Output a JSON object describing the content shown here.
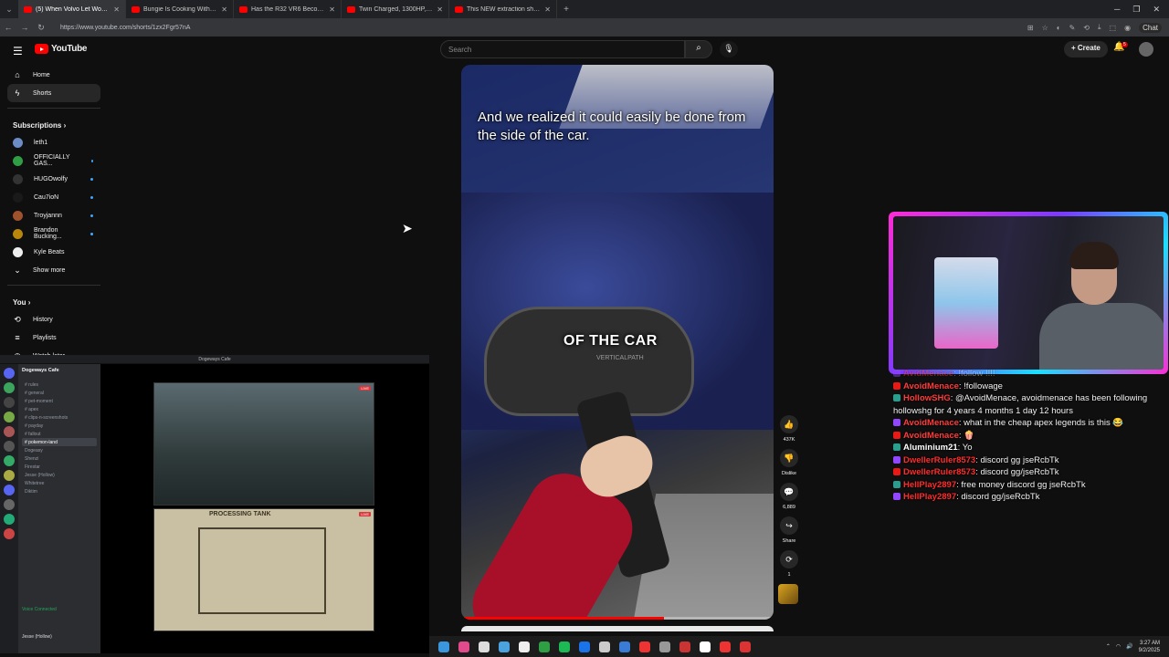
{
  "browser": {
    "tabs": [
      {
        "title": "(5) When Volvo Let Women D...",
        "active": true
      },
      {
        "title": "Bungie Is Cooking With This...",
        "active": false
      },
      {
        "title": "Has the R32 VR6 Become TOO C...",
        "active": false
      },
      {
        "title": "Twin Charged, 1300HP, No Lag...",
        "active": false
      },
      {
        "title": "This NEW extraction shooter is W...",
        "active": false
      }
    ],
    "url": "https://www.youtube.com/shorts/1zx2Fgr57nA",
    "chat_label": "Chat"
  },
  "youtube": {
    "logo_text": "YouTube",
    "search_placeholder": "Search",
    "create_label": "Create",
    "notif_count": "5",
    "sidebar": {
      "home": "Home",
      "shorts": "Shorts",
      "subscriptions_header": "Subscriptions",
      "subscriptions": [
        {
          "name": "leth1",
          "color": "#6b8cc7",
          "live": false
        },
        {
          "name": "OFFICIALLY GAS...",
          "color": "#2f9e44",
          "live": true
        },
        {
          "name": "HUGOwolfy",
          "color": "#333",
          "live": true
        },
        {
          "name": "Cau7ioN",
          "color": "#1a1a1a",
          "live": true
        },
        {
          "name": "Troyjannn",
          "color": "#a0522d",
          "live": true
        },
        {
          "name": "Brandon Bucking...",
          "color": "#b8860b",
          "live": true
        },
        {
          "name": "Kyle Beats",
          "color": "#eee",
          "live": false
        }
      ],
      "show_more": "Show more",
      "you_header": "You",
      "history": "History",
      "playlists": "Playlists",
      "watch_later": "Watch later"
    },
    "short": {
      "caption": "And we realized it could easily be done from the side of the car.",
      "overlay_text": "OF THE CAR",
      "overlay_sub": "VERTICALPATH",
      "progress": 0.65
    },
    "actions": {
      "like_count": "437K",
      "dislike_label": "Dislike",
      "comment_count": "6,889",
      "share_label": "Share",
      "remix_count": "1"
    }
  },
  "stream_chat": [
    {
      "user": "AvidMenace",
      "text": ": !follow !!!!",
      "color": "#ff3b3b",
      "dim": true
    },
    {
      "user": "AvoidMenace",
      "text": ": !followage",
      "color": "#ff3b3b",
      "dim": false
    },
    {
      "user": "HollowSHG",
      "text": ": @AvoidMenace, avoidmenace has been following hollowshg for 4 years 4 months 1 day 12 hours",
      "color": "#ff3b3b",
      "dim": false
    },
    {
      "user": "AvoidMenace",
      "text": ": what in the cheap apex legends is this 😂",
      "color": "#ff3b3b",
      "dim": false
    },
    {
      "user": "AvoidMenace",
      "text": ": 🍿",
      "color": "#ff3b3b",
      "dim": false
    },
    {
      "user": "Aluminium21",
      "text": ": Yo",
      "color": "#ffffff",
      "dim": false
    },
    {
      "user": "DwellerRuler8573",
      "text": ": discord gg jseRcbTk",
      "color": "#ff2b2b",
      "dim": false
    },
    {
      "user": "DwellerRuler8573",
      "text": ": discord gg/jseRcbTk",
      "color": "#ff2b2b",
      "dim": false
    },
    {
      "user": "HellPlay2897",
      "text": ": free money discord gg jseRcbTk",
      "color": "#ff2b2b",
      "dim": false
    },
    {
      "user": "HellPlay2897",
      "text": ": discord gg/jseRcbTk",
      "color": "#ff2b2b",
      "dim": false
    }
  ],
  "discord": {
    "window_title": "Dogeways Cafe",
    "server_name": "Dogeways Cafe",
    "channels": [
      "rules",
      "general",
      "pet-moment",
      "apex",
      "clips-n-screenshots",
      "payday",
      "fallout",
      "pokemon-land",
      "Dogeasy",
      "Shenzi",
      "Firestar",
      "Jesse (Hollow)",
      "Whitetree",
      "Diktim"
    ],
    "voice_status": "Voice Connected",
    "user": "Jesse (Hollow)",
    "game2_title": "PROCESSING TANK"
  },
  "taskbar": {
    "time": "3:27 AM",
    "date": "9/2/2025"
  }
}
